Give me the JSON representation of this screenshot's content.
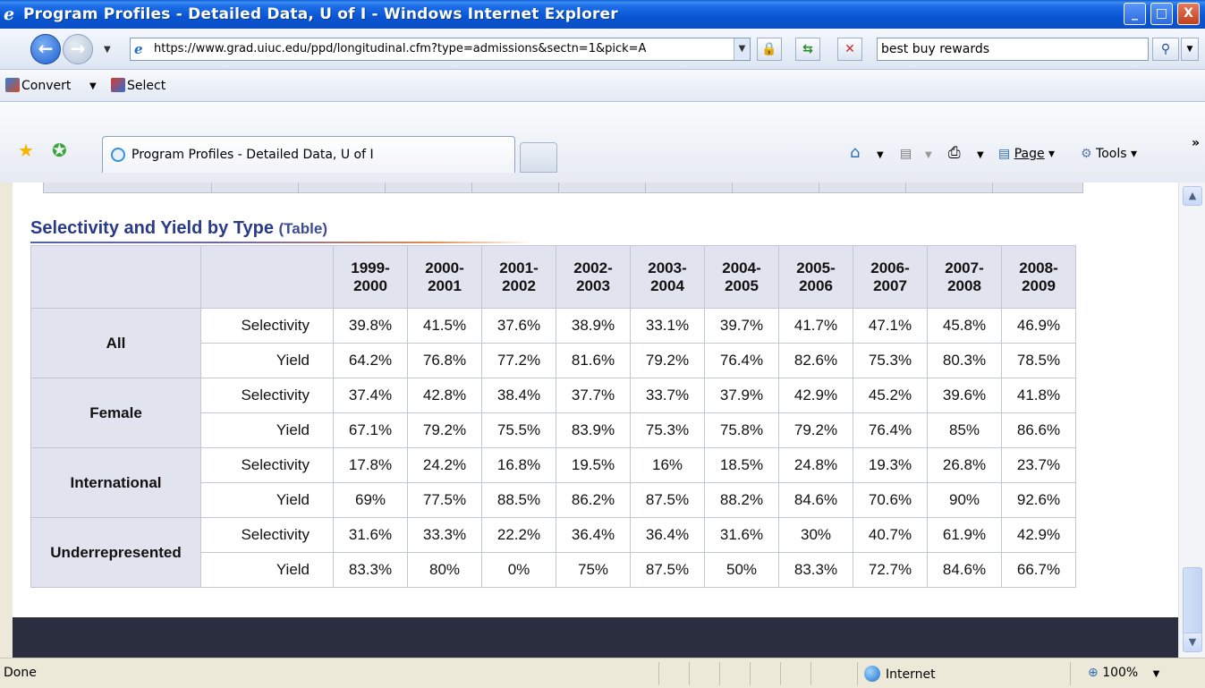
{
  "window": {
    "title": "Program Profiles - Detailed Data, U of I - Windows Internet Explorer",
    "controls": {
      "minimize": "_",
      "maximize": "□",
      "close": "X"
    }
  },
  "address_bar": {
    "url": "https://www.grad.uiuc.edu/ppd/longitudinal.cfm?type=admissions&sectn=1&pick=A",
    "search_value": "best buy rewards"
  },
  "command_bar": {
    "convert_label": "Convert",
    "select_label": "Select"
  },
  "tabs": [
    {
      "label": "Program Profiles - Detailed Data, U of I",
      "active": true
    }
  ],
  "tab_toolbar": {
    "page_label": "Page",
    "tools_label": "Tools",
    "chevron": "»"
  },
  "content": {
    "heading": "Selectivity and Yield by Type",
    "heading_suffix": "(Table)",
    "columns": [
      "1999-\n2000",
      "2000-\n2001",
      "2001-\n2002",
      "2002-\n2003",
      "2003-\n2004",
      "2004-\n2005",
      "2005-\n2006",
      "2006-\n2007",
      "2007-\n2008",
      "2008-\n2009"
    ],
    "groups": [
      {
        "name": "All",
        "rows": [
          {
            "metric": "Selectivity",
            "values": [
              "39.8%",
              "41.5%",
              "37.6%",
              "38.9%",
              "33.1%",
              "39.7%",
              "41.7%",
              "47.1%",
              "45.8%",
              "46.9%"
            ]
          },
          {
            "metric": "Yield",
            "values": [
              "64.2%",
              "76.8%",
              "77.2%",
              "81.6%",
              "79.2%",
              "76.4%",
              "82.6%",
              "75.3%",
              "80.3%",
              "78.5%"
            ]
          }
        ]
      },
      {
        "name": "Female",
        "rows": [
          {
            "metric": "Selectivity",
            "values": [
              "37.4%",
              "42.8%",
              "38.4%",
              "37.7%",
              "33.7%",
              "37.9%",
              "42.9%",
              "45.2%",
              "39.6%",
              "41.8%"
            ]
          },
          {
            "metric": "Yield",
            "values": [
              "67.1%",
              "79.2%",
              "75.5%",
              "83.9%",
              "75.3%",
              "75.8%",
              "79.2%",
              "76.4%",
              "85%",
              "86.6%"
            ]
          }
        ]
      },
      {
        "name": "International",
        "rows": [
          {
            "metric": "Selectivity",
            "values": [
              "17.8%",
              "24.2%",
              "16.8%",
              "19.5%",
              "16%",
              "18.5%",
              "24.8%",
              "19.3%",
              "26.8%",
              "23.7%"
            ]
          },
          {
            "metric": "Yield",
            "values": [
              "69%",
              "77.5%",
              "88.5%",
              "86.2%",
              "87.5%",
              "88.2%",
              "84.6%",
              "70.6%",
              "90%",
              "92.6%"
            ]
          }
        ]
      },
      {
        "name": "Underrepresented",
        "rows": [
          {
            "metric": "Selectivity",
            "values": [
              "31.6%",
              "33.3%",
              "22.2%",
              "36.4%",
              "36.4%",
              "31.6%",
              "30%",
              "40.7%",
              "61.9%",
              "42.9%"
            ]
          },
          {
            "metric": "Yield",
            "values": [
              "83.3%",
              "80%",
              "0%",
              "75%",
              "87.5%",
              "50%",
              "83.3%",
              "72.7%",
              "84.6%",
              "66.7%"
            ]
          }
        ]
      }
    ]
  },
  "status_bar": {
    "status_text": "Done",
    "zone": "Internet",
    "zoom": "100%"
  },
  "icons": {
    "back": "back-arrow-icon",
    "forward": "forward-arrow-icon",
    "lock": "lock-icon",
    "refresh": "refresh-icon",
    "stop": "stop-icon",
    "search": "search-icon",
    "favorites": "favorites-star-icon",
    "add_favorites": "add-favorites-icon",
    "home": "home-icon",
    "feeds": "feeds-icon",
    "print": "print-icon",
    "tools": "gear-icon",
    "internet_zone": "globe-icon"
  },
  "colors": {
    "titlebar": "#0a55d4",
    "heading": "#2a3a88",
    "table_header_bg": "#e1e3ee",
    "footer": "#2b2e3e"
  }
}
